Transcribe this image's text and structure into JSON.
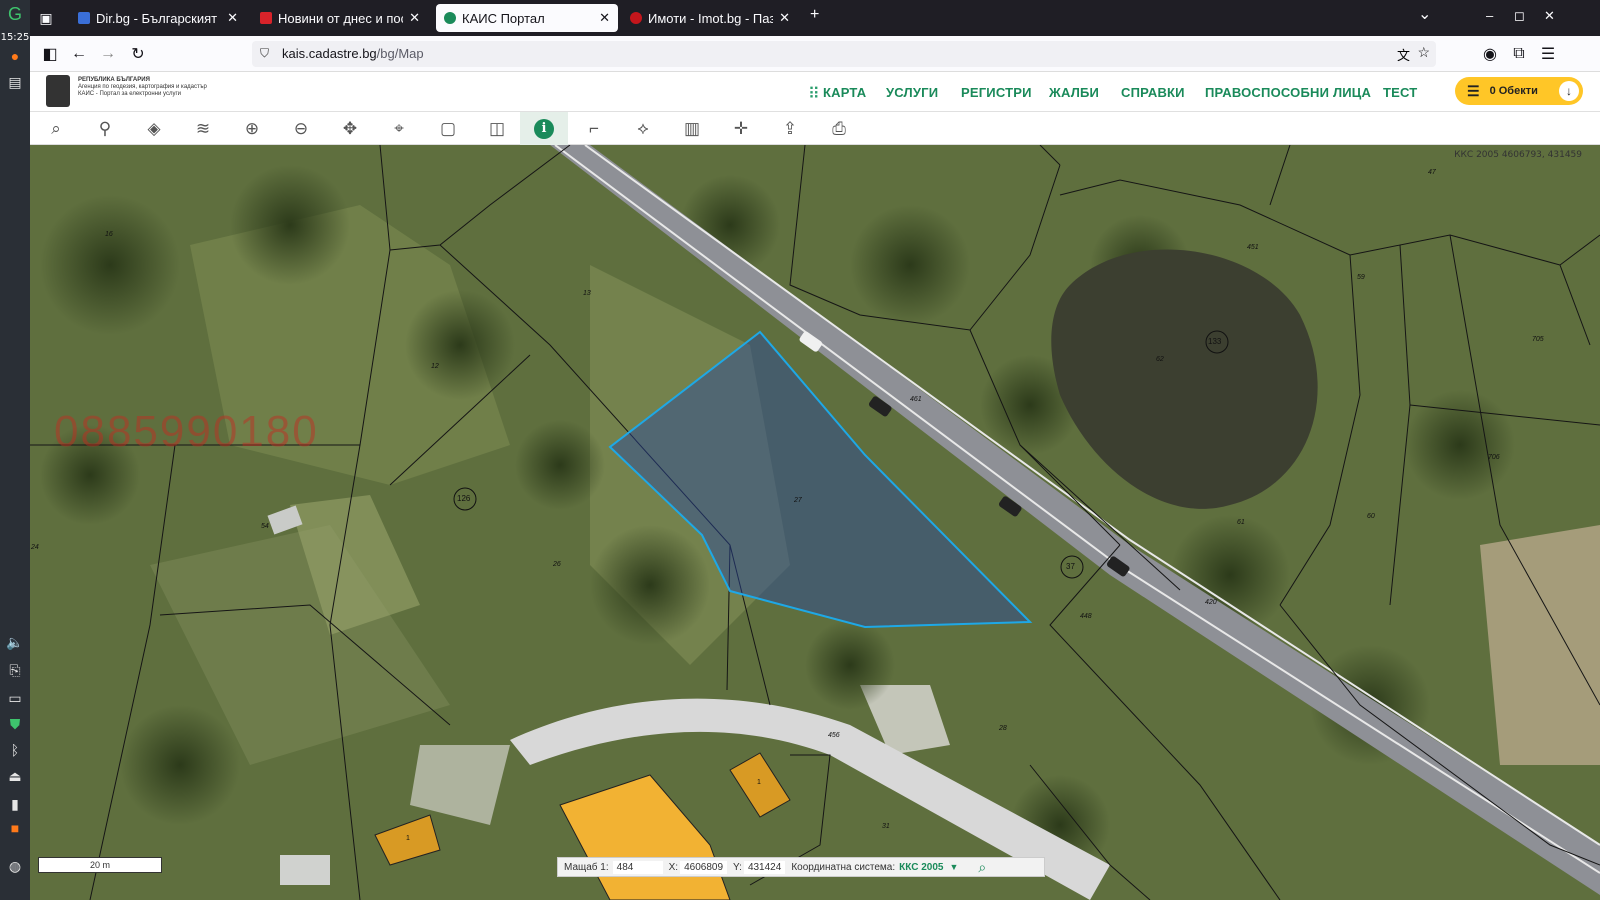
{
  "os": {
    "clock": "15:25"
  },
  "tabs": [
    {
      "title": "Dir.bg - Българският инт",
      "color": "#3a6fd8"
    },
    {
      "title": "Новини от днес и после,",
      "color": "#d8232a"
    },
    {
      "title": "КАИС Портал",
      "color": "#1a8a5a"
    },
    {
      "title": "Имоти - Imot.bg - Пазар",
      "color": "#c4161c"
    }
  ],
  "window_controls": {
    "min": "–",
    "max": "◻",
    "close": "✕",
    "tab_list": "⌄",
    "new_tab": "+"
  },
  "address_bar": {
    "host": "kais.cadastre.bg",
    "path": "/bg/Map"
  },
  "site": {
    "logo_lines": [
      "РЕПУБЛИКА БЪЛГАРИЯ",
      "Агенция по геодезия, картография и кадастър",
      "КАИС - Портал за електронни услуги"
    ],
    "menu": [
      "КАРТА",
      "УСЛУГИ",
      "РЕГИСТРИ",
      "ЖАЛБИ",
      "СПРАВКИ",
      "ПРАВОСПОСОБНИ ЛИЦА",
      "ТЕСТ"
    ],
    "cart_label": "0 Обекти"
  },
  "map": {
    "watermark": "0885990180",
    "crs_readout": "ККС 2005 4606793, 431459",
    "parcel_labels": [
      "16",
      "13",
      "12",
      "126",
      "133",
      "461",
      "62",
      "27",
      "37",
      "26",
      "54",
      "451",
      "59",
      "705",
      "706",
      "61",
      "60",
      "420",
      "448",
      "456",
      "28",
      "24",
      "1",
      "1",
      "31",
      "47"
    ],
    "scale_label": "20 m",
    "status": {
      "scale_label": "Мащаб 1:",
      "scale_value": "484",
      "x_label": "X:",
      "x_value": "4606809",
      "y_label": "Y:",
      "y_value": "431424",
      "crs_label": "Координатна система:",
      "crs_value": "ККС 2005"
    }
  }
}
